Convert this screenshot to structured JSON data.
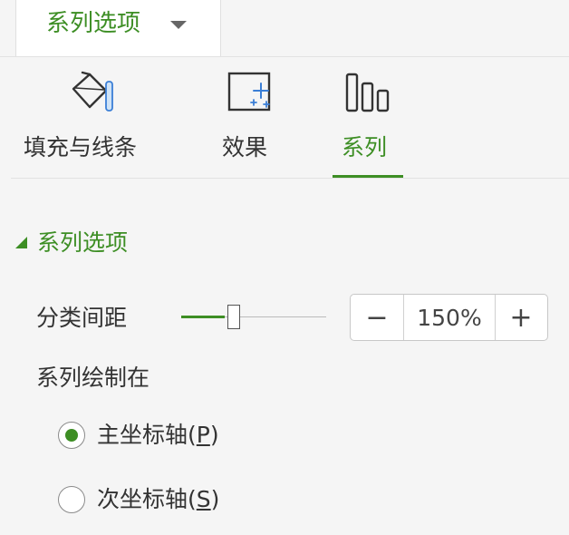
{
  "header": {
    "title": "系列选项",
    "caret_icon": "chevron-down-icon"
  },
  "category_tabs": [
    {
      "label": "填充与线条",
      "icon": "paint-bucket-icon",
      "active": false
    },
    {
      "label": "效果",
      "icon": "effects-icon",
      "active": false
    },
    {
      "label": "系列",
      "icon": "series-bars-icon",
      "active": true
    }
  ],
  "section": {
    "title": "系列选项",
    "expanded": true
  },
  "gap_width": {
    "label": "分类间距",
    "value_text": "150%",
    "slider_fraction": 0.3,
    "minus_label": "−",
    "plus_label": "+"
  },
  "plot_on": {
    "label": "系列绘制在",
    "options": [
      {
        "text": "主坐标轴(",
        "key": "P",
        "close": ")",
        "selected": true
      },
      {
        "text": "次坐标轴(",
        "key": "S",
        "close": ")",
        "selected": false
      }
    ]
  },
  "colors": {
    "accent": "#3d8e24",
    "background": "#f5f5f5",
    "text": "#333333"
  }
}
